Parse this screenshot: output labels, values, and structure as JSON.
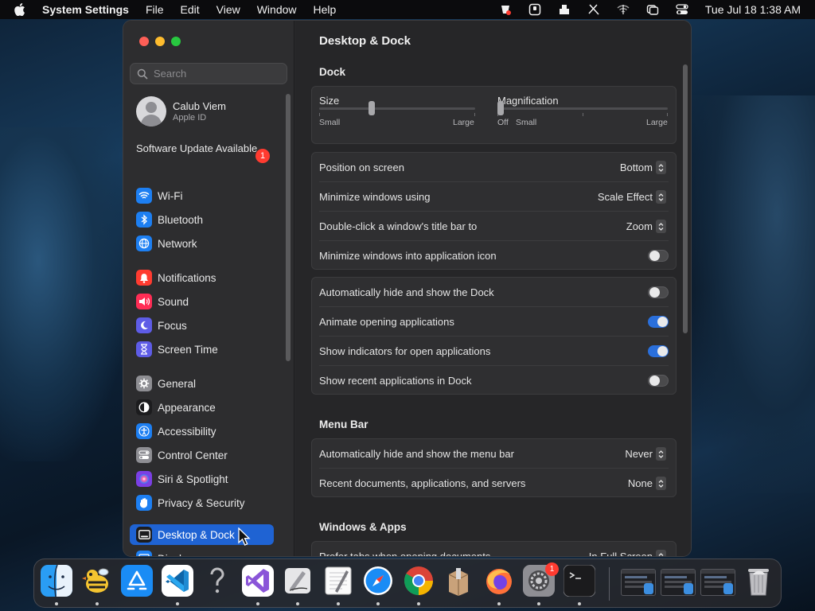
{
  "menubar": {
    "app_name": "System Settings",
    "items": [
      "File",
      "Edit",
      "View",
      "Window",
      "Help"
    ],
    "clock": "Tue Jul 18  1:38 AM"
  },
  "sidebar": {
    "search_placeholder": "Search",
    "user": {
      "name": "Calub Viem",
      "subtitle": "Apple ID"
    },
    "update": {
      "label": "Software Update Available",
      "badge": "1"
    },
    "items": [
      {
        "label": "Wi-Fi",
        "icon": "wifi-icon",
        "color": "#1d7ff2"
      },
      {
        "label": "Bluetooth",
        "icon": "bluetooth-icon",
        "color": "#1d7ff2"
      },
      {
        "label": "Network",
        "icon": "globe-icon",
        "color": "#1d7ff2"
      },
      {
        "label": "Notifications",
        "icon": "bell-icon",
        "color": "#ff3b30"
      },
      {
        "label": "Sound",
        "icon": "speaker-icon",
        "color": "#ff2d55"
      },
      {
        "label": "Focus",
        "icon": "moon-icon",
        "color": "#5e5ce6"
      },
      {
        "label": "Screen Time",
        "icon": "hourglass-icon",
        "color": "#5e5ce6"
      },
      {
        "label": "General",
        "icon": "gear-icon",
        "color": "#8e8e93"
      },
      {
        "label": "Appearance",
        "icon": "appearance-icon",
        "color": "#1c1c1e"
      },
      {
        "label": "Accessibility",
        "icon": "accessibility-icon",
        "color": "#1d7ff2"
      },
      {
        "label": "Control Center",
        "icon": "control-center-icon",
        "color": "#8e8e93"
      },
      {
        "label": "Siri & Spotlight",
        "icon": "siri-icon",
        "color": "#7b3fe4"
      },
      {
        "label": "Privacy & Security",
        "icon": "hand-icon",
        "color": "#1d7ff2"
      },
      {
        "label": "Desktop & Dock",
        "icon": "dock-icon",
        "color": "#1c1c1e",
        "active": true
      },
      {
        "label": "Displays",
        "icon": "display-icon",
        "color": "#1d7ff2"
      }
    ]
  },
  "content": {
    "title": "Desktop & Dock",
    "dock_section": "Dock",
    "size": {
      "label": "Size",
      "min_label": "Small",
      "max_label": "Large",
      "value": 0.33
    },
    "magnification": {
      "label": "Magnification",
      "off_label": "Off",
      "min_label": "Small",
      "max_label": "Large",
      "value": 0.0
    },
    "position_rows": [
      {
        "label": "Position on screen",
        "value": "Bottom"
      },
      {
        "label": "Minimize windows using",
        "value": "Scale Effect"
      },
      {
        "label": "Double-click a window's title bar to",
        "value": "Zoom"
      },
      {
        "label": "Minimize windows into application icon",
        "toggle": false
      }
    ],
    "toggle_rows": [
      {
        "label": "Automatically hide and show the Dock",
        "toggle": false
      },
      {
        "label": "Animate opening applications",
        "toggle": true
      },
      {
        "label": "Show indicators for open applications",
        "toggle": true
      },
      {
        "label": "Show recent applications in Dock",
        "toggle": false
      }
    ],
    "menubar_section": "Menu Bar",
    "menubar_rows": [
      {
        "label": "Automatically hide and show the menu bar",
        "value": "Never"
      },
      {
        "label": "Recent documents, applications, and servers",
        "value": "None"
      }
    ],
    "windows_section": "Windows & Apps",
    "windows_rows": [
      {
        "label": "Prefer tabs when opening documents",
        "value": "In Full Screen"
      }
    ]
  },
  "dock": {
    "apps": [
      {
        "name": "finder-icon",
        "running": true
      },
      {
        "name": "cyberduck-icon",
        "running": true
      },
      {
        "name": "app-store-icon",
        "running": false
      },
      {
        "name": "vscode-icon",
        "running": true
      },
      {
        "name": "help-icon",
        "running": false
      },
      {
        "name": "visual-studio-icon",
        "running": true
      },
      {
        "name": "script-editor-icon",
        "running": true
      },
      {
        "name": "textedit-icon",
        "running": true
      },
      {
        "name": "safari-icon",
        "running": true
      },
      {
        "name": "chrome-icon",
        "running": true
      },
      {
        "name": "archive-utility-icon",
        "running": false
      },
      {
        "name": "firefox-icon",
        "running": true
      },
      {
        "name": "system-settings-icon",
        "running": true,
        "badge": "1"
      },
      {
        "name": "terminal-icon",
        "running": true
      }
    ]
  },
  "colors": {
    "accent": "#1f63d3",
    "toggle_on": "#2a6fdb",
    "badge": "#ff3b30"
  }
}
